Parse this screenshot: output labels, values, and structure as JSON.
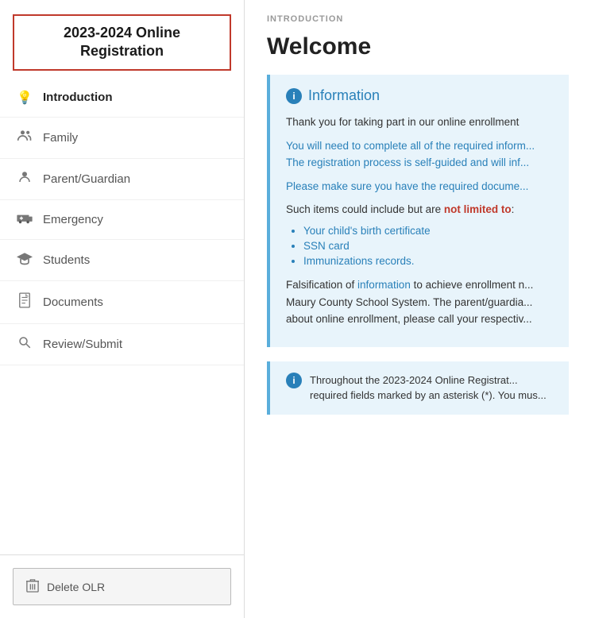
{
  "sidebar": {
    "title": "2023-2024 Online\nRegistration",
    "nav_items": [
      {
        "id": "introduction",
        "label": "Introduction",
        "icon": "bulb",
        "active": true
      },
      {
        "id": "family",
        "label": "Family",
        "icon": "family"
      },
      {
        "id": "parent-guardian",
        "label": "Parent/Guardian",
        "icon": "person"
      },
      {
        "id": "emergency",
        "label": "Emergency",
        "icon": "ambulance"
      },
      {
        "id": "students",
        "label": "Students",
        "icon": "graduation"
      },
      {
        "id": "documents",
        "label": "Documents",
        "icon": "document"
      },
      {
        "id": "review-submit",
        "label": "Review/Submit",
        "icon": "search"
      }
    ],
    "delete_button_label": "Delete OLR"
  },
  "main": {
    "section_header": "INTRODUCTION",
    "welcome_title": "Welcome",
    "info_box": {
      "title": "Information",
      "paragraphs": [
        "Thank you for taking part in our online enrollment",
        "You will need to complete all of the required inform... The registration process is self-guided and will inf...",
        "Please make sure you have the required docume...",
        "Such items could include but are not limited to:"
      ],
      "list_items": [
        "Your child's birth certificate",
        "SSN card",
        "Immunizations records."
      ],
      "footer_text": "Falsification of information to achieve enrollment n... Maury County School System. The parent/guardia... about online enrollment, please call your respectiv..."
    },
    "notice_box": {
      "text": "Throughout the 2023-2024 Online Registrat... required fields marked by an asterisk (*). You mus..."
    }
  }
}
